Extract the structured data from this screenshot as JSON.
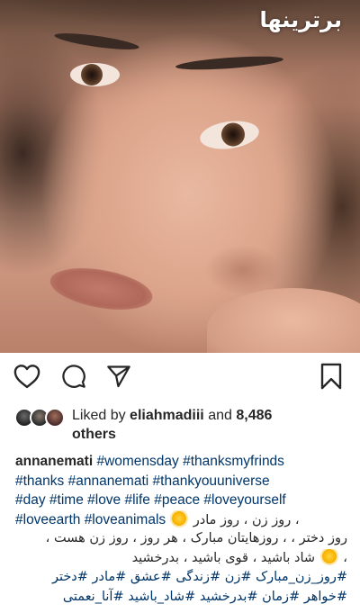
{
  "post": {
    "watermark": "برترینها",
    "likes": {
      "prefix": "Liked by ",
      "user": "eliahmadiii",
      "middle": " and ",
      "count": "8,486",
      "suffix": "others"
    },
    "caption": {
      "username": "annanemati",
      "line1_tags": " #womensday #thanksmyfrinds",
      "line2_tags": "#thanks #annanemati #thankyouuniverse",
      "line3_tags": "#day #time #love #life #peace #loveyourself",
      "line4_tags": "#loveearth #loveanimals",
      "line4_rtl": "روز زن ، روز مادر ،",
      "rtl_line1": "روز دختر ، ، روزهایتان مبارک ، هر روز ، روز زن هست ،",
      "rtl_line2_a": "، ",
      "rtl_line2_b": " شاد باشید ، قوی باشید ، بدرخشید",
      "rtl_tags1": "#روز_زن_مبارک #زن #زندگی #عشق #مادر #دختر",
      "rtl_tags2": "#خواهر #زمان #بدرخشید #شاد_باشید #آنا_نعمتی"
    }
  },
  "icons": {
    "like": "heart-icon",
    "comment": "comment-bubble-icon",
    "share": "paper-plane-icon",
    "save": "bookmark-icon",
    "sun": "sun-emoji-icon"
  },
  "colors": {
    "text": "#262626",
    "hashtag": "#003569",
    "background": "#ffffff"
  }
}
